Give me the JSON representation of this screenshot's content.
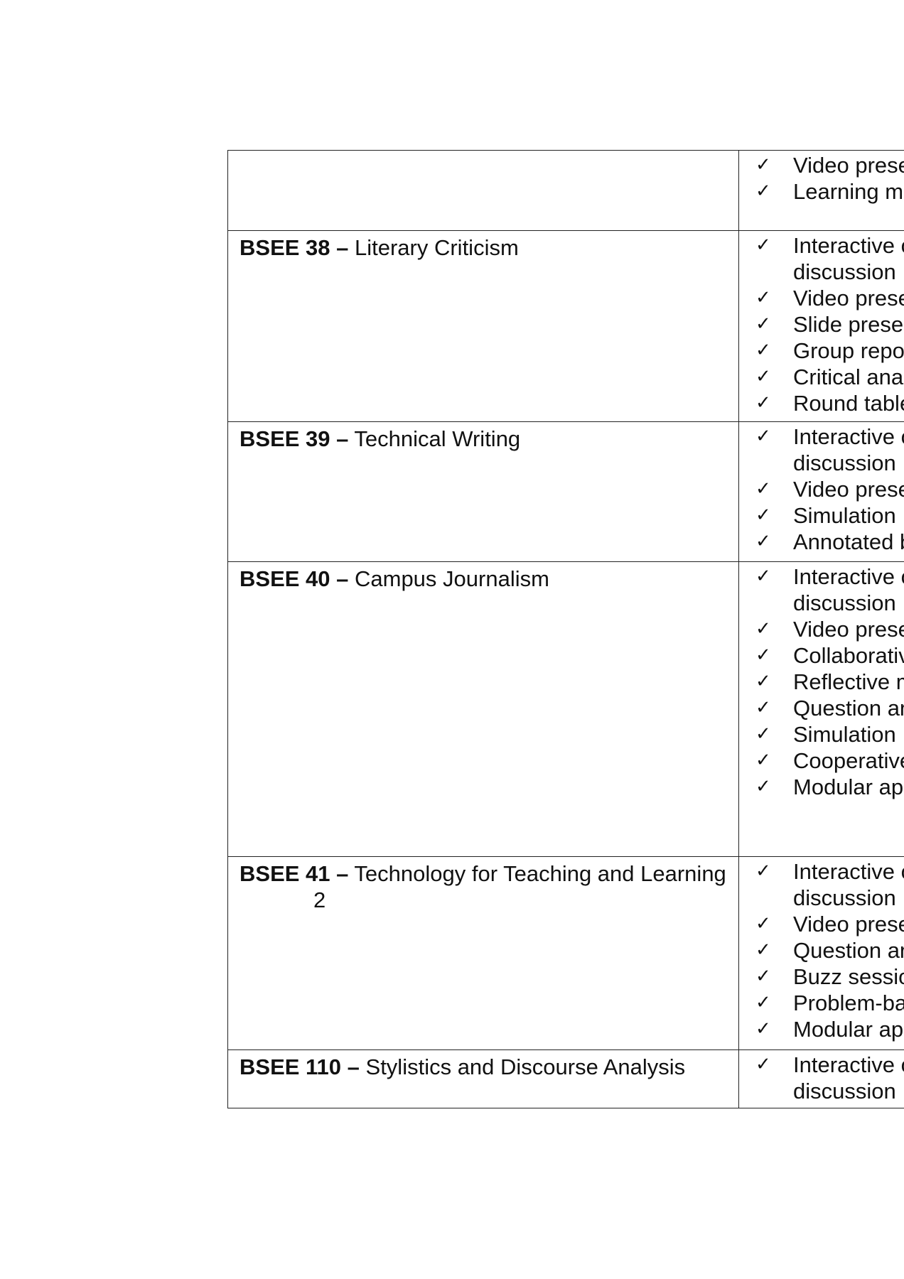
{
  "table": {
    "rows": [
      {
        "course_code": "",
        "course_title": "",
        "strategies": [
          "Video presen",
          "Learning moc"
        ],
        "row_height": 112
      },
      {
        "course_code": "BSEE 38 –",
        "course_title": " Literary Criticism",
        "strategies": [
          "Interactive or\ndiscussion",
          "Video presen",
          "Slide present",
          "Group reporti",
          "Critical analys",
          "Round table c"
        ],
        "row_height": 268
      },
      {
        "course_code": "BSEE 39 –",
        "course_title": " Technical Writing",
        "strategies": [
          "Interactive or\ndiscussion",
          "Video presen",
          "Simulation",
          "Annotated bib"
        ],
        "row_height": 196
      },
      {
        "course_code": "BSEE 40 –",
        "course_title": " Campus Journalism",
        "strategies": [
          "Interactive or\ndiscussion",
          "Video presen",
          "Collaborative",
          "Reflective me",
          "Question and",
          "Simulation",
          "Cooperative l",
          "Modular appr"
        ],
        "row_height": 414
      },
      {
        "course_code": "BSEE 41 –",
        "course_title": " Technology for Teaching and Learning 2",
        "strategies": [
          "Interactive or\ndiscussion",
          "Video presen",
          "Question and",
          "Buzz session",
          "Problem-base",
          "Modular appr"
        ],
        "row_height": 271
      },
      {
        "course_code": "BSEE 110 –",
        "course_title": " Stylistics and Discourse Analysis",
        "strategies": [
          "Interactive or\ndiscussion"
        ],
        "row_height": 81
      }
    ]
  },
  "icons": {
    "check": "check-icon"
  }
}
